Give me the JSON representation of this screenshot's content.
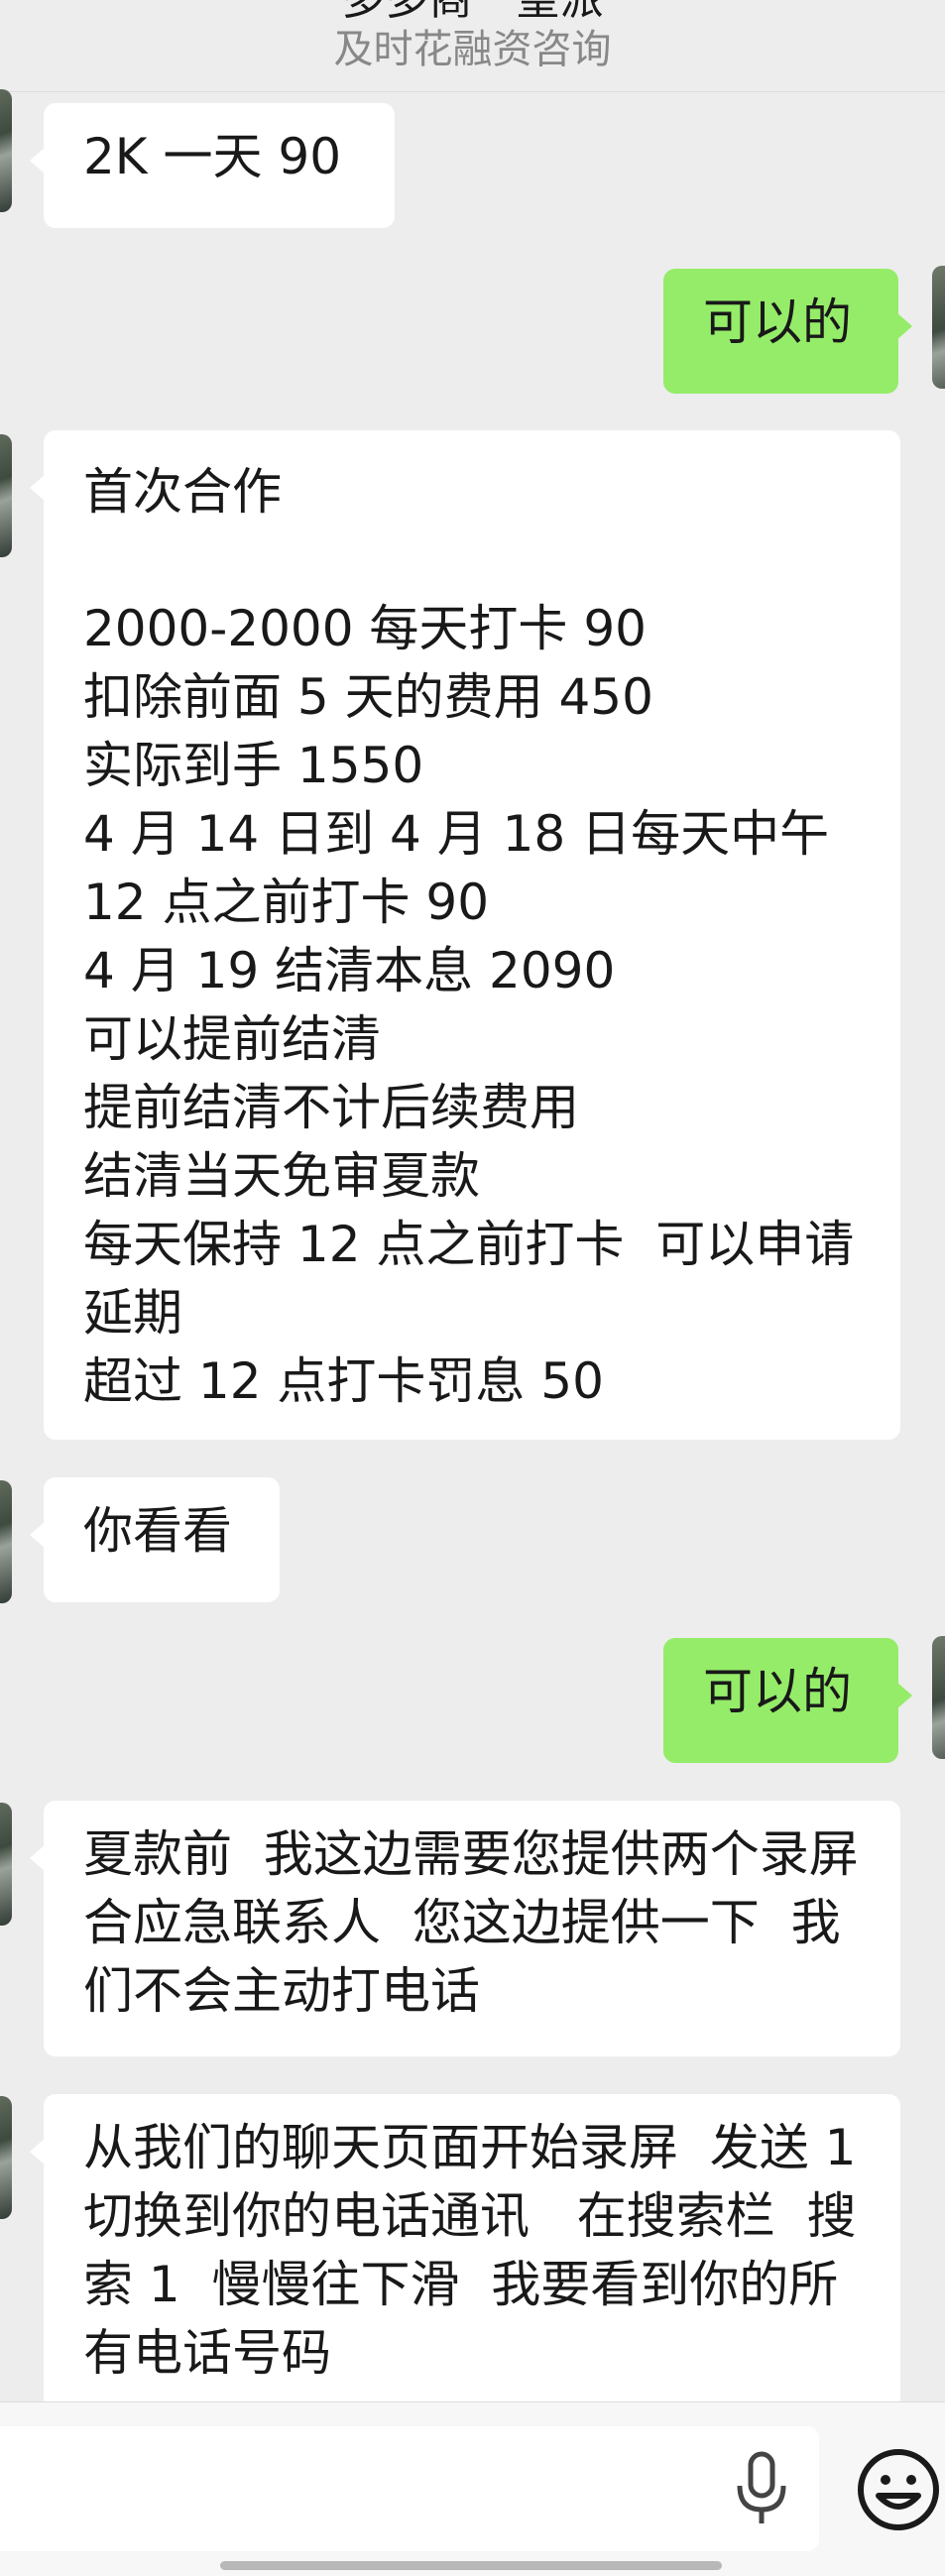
{
  "header": {
    "title": "多多商一望派",
    "subtitle": "及时花融资咨询"
  },
  "messages": [
    {
      "side": "in",
      "text": "2K 一天 90"
    },
    {
      "side": "out",
      "text": "可以的"
    },
    {
      "side": "in",
      "text": "首次合作\n\n2000-2000 每天打卡 90\n扣除前面 5 天的费用 450\n实际到手 1550\n4 月 14 日到 4 月 18 日每天中午 12 点之前打卡 90\n4 月 19 结清本息 2090\n可以提前结清\n提前结清不计后续费用\n结清当天免审夏款\n每天保持 12 点之前打卡  可以申请延期\n超过 12 点打卡罚息 50"
    },
    {
      "side": "in",
      "text": "你看看"
    },
    {
      "side": "out",
      "text": "可以的"
    },
    {
      "side": "in",
      "text": "夏款前  我这边需要您提供两个录屏 合应急联系人  您这边提供一下  我们不会主动打电话"
    },
    {
      "side": "in",
      "text": "从我们的聊天页面开始录屏  发送 1  切换到你的电话通讯   在搜索栏  搜索 1  慢慢往下滑  我要看到你的所有电话号码"
    }
  ],
  "input": {
    "placeholder": ""
  },
  "icons": {
    "mic": "microphone-icon",
    "emoji": "emoji-icon"
  },
  "colors": {
    "background": "#ededed",
    "incoming_bubble": "#ffffff",
    "outgoing_bubble": "#95ec69"
  }
}
